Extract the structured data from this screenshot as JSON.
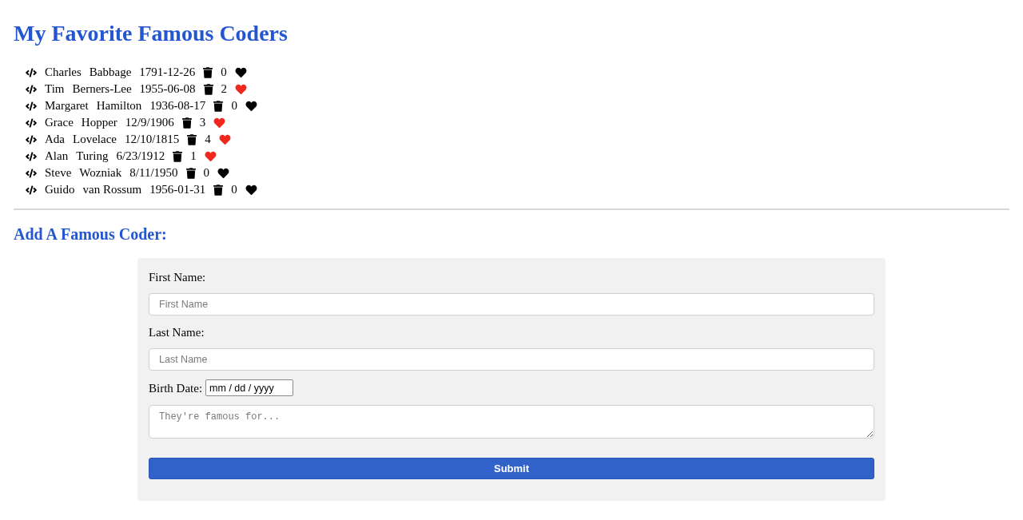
{
  "title": "My Favorite Famous Coders",
  "coders": [
    {
      "first_name": "Charles",
      "last_name": "Babbage",
      "birth_date": "1791-12-26",
      "likes": "0",
      "liked": false
    },
    {
      "first_name": "Tim",
      "last_name": "Berners-Lee",
      "birth_date": "1955-06-08",
      "likes": "2",
      "liked": true
    },
    {
      "first_name": "Margaret",
      "last_name": "Hamilton",
      "birth_date": "1936-08-17",
      "likes": "0",
      "liked": false
    },
    {
      "first_name": "Grace",
      "last_name": "Hopper",
      "birth_date": "12/9/1906",
      "likes": "3",
      "liked": true
    },
    {
      "first_name": "Ada",
      "last_name": "Lovelace",
      "birth_date": "12/10/1815",
      "likes": "4",
      "liked": true
    },
    {
      "first_name": "Alan",
      "last_name": "Turing",
      "birth_date": "6/23/1912",
      "likes": "1",
      "liked": true
    },
    {
      "first_name": "Steve",
      "last_name": "Wozniak",
      "birth_date": "8/11/1950",
      "likes": "0",
      "liked": false
    },
    {
      "first_name": "Guido",
      "last_name": "van Rossum",
      "birth_date": "1956-01-31",
      "likes": "0",
      "liked": false
    }
  ],
  "form": {
    "heading": "Add A Famous Coder:",
    "fields": [
      {
        "kind": "text",
        "label": "First Name:",
        "placeholder": "First Name"
      },
      {
        "kind": "text",
        "label": "Last Name:",
        "placeholder": "Last Name"
      },
      {
        "kind": "date",
        "label": "Birth Date:",
        "placeholder": "mm / dd / yyyy"
      },
      {
        "kind": "textarea",
        "placeholder": "They're famous for..."
      }
    ],
    "submit": "Submit"
  }
}
